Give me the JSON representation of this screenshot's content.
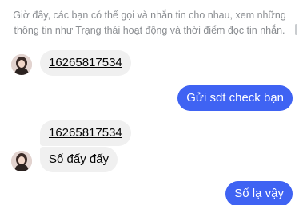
{
  "system_note": {
    "line1": "Giờ đây, các bạn có thể gọi và nhắn tin cho nhau, xem những",
    "line2": "thông tin như Trạng thái hoạt động và thời điểm đọc tin nhắn."
  },
  "messages": [
    {
      "sender": "contact",
      "text": "16265817534",
      "kind": "phone-link"
    },
    {
      "sender": "me",
      "text": "Gửi sdt check bạn"
    },
    {
      "sender": "contact",
      "text": "16265817534",
      "kind": "phone-link"
    },
    {
      "sender": "contact",
      "text": "Số đấy đấy"
    },
    {
      "sender": "me",
      "text": "Số lạ vậy"
    }
  ],
  "colors": {
    "outgoing_bubble": "#3f63f3",
    "incoming_bubble": "#f0f0f0",
    "system_text": "#8a8d91"
  },
  "icons": {
    "contact_avatar": "contact-avatar"
  }
}
